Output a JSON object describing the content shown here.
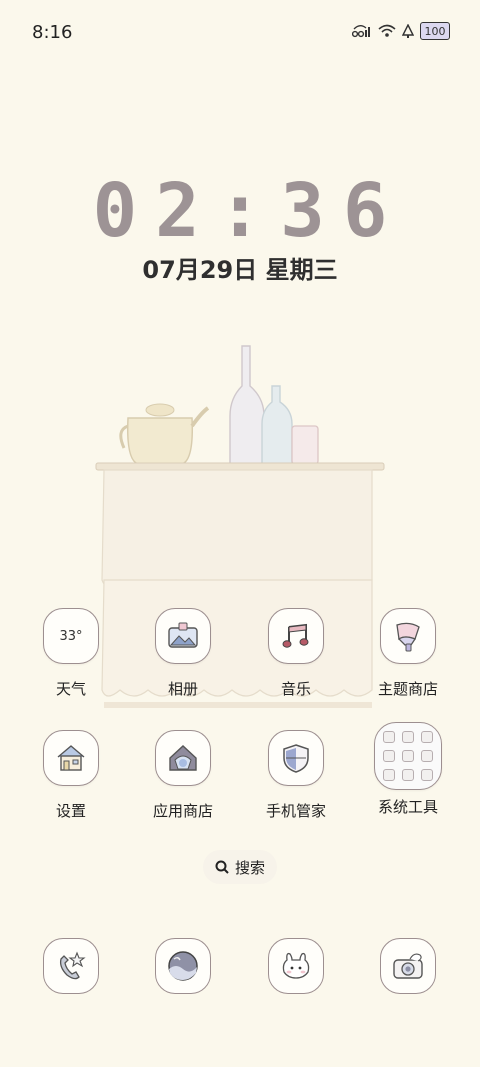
{
  "status_bar": {
    "time": "8:16",
    "battery": "100"
  },
  "clock": {
    "time": "02:36",
    "date": "07月29日 星期三"
  },
  "apps": [
    {
      "label": "天气",
      "icon": "weather-icon",
      "badge": "33°"
    },
    {
      "label": "相册",
      "icon": "gallery-icon"
    },
    {
      "label": "音乐",
      "icon": "music-icon"
    },
    {
      "label": "主题商店",
      "icon": "theme-store-icon"
    },
    {
      "label": "设置",
      "icon": "settings-icon"
    },
    {
      "label": "应用商店",
      "icon": "app-store-icon"
    },
    {
      "label": "手机管家",
      "icon": "phone-manager-icon"
    },
    {
      "label": "系统工具",
      "icon": "system-tools-folder-icon"
    }
  ],
  "search": {
    "label": "搜索"
  },
  "dock": [
    {
      "icon": "phone-icon"
    },
    {
      "icon": "browser-icon"
    },
    {
      "icon": "messages-icon"
    },
    {
      "icon": "camera-icon"
    }
  ],
  "colors": {
    "background": "#fbf8ec",
    "clock": "#9d9395",
    "icon_border": "#9d8f90"
  }
}
